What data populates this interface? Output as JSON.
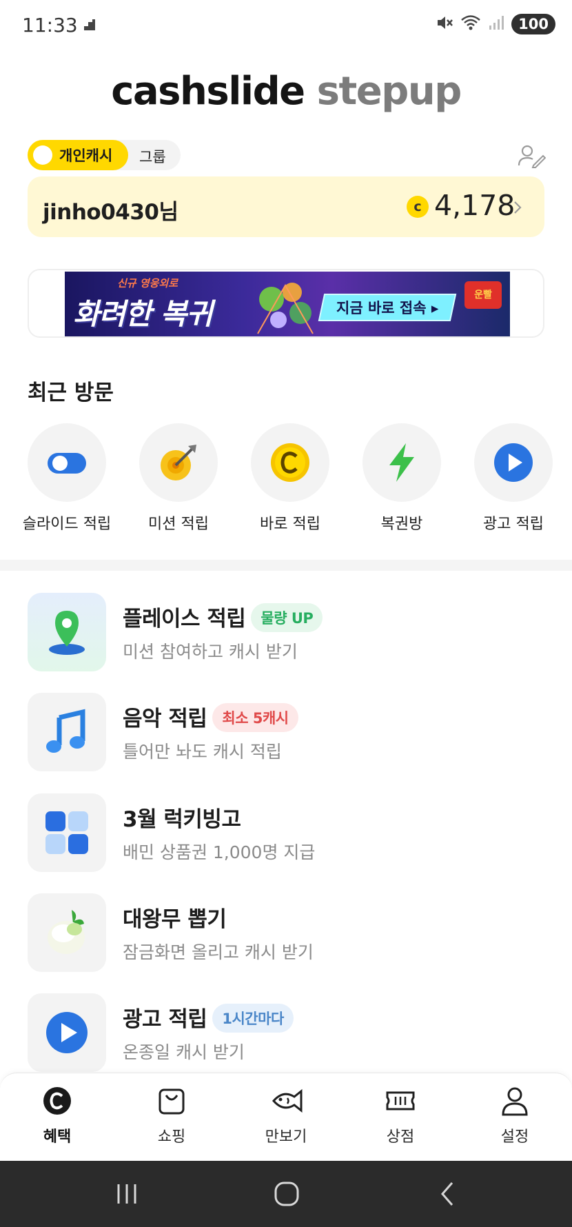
{
  "status_bar": {
    "time": "11:33",
    "battery": "100"
  },
  "logo": {
    "word1": "cashslide",
    "word2": "stepup"
  },
  "toggle": {
    "active_label": "개인캐시",
    "inactive_label": "그룹"
  },
  "cash_card": {
    "username": "jinho0430님",
    "coin_symbol": "c",
    "amount": "4,178"
  },
  "banner": {
    "subtitle": "신규 영웅외로",
    "headline": "화려한 복귀",
    "cta": "지금 바로 접속 ▸",
    "brand": "운빨"
  },
  "recent": {
    "title": "최근 방문",
    "items": [
      {
        "label": "슬라이드 적립",
        "icon": "toggle-switch-icon"
      },
      {
        "label": "미션 적립",
        "icon": "target-dart-icon"
      },
      {
        "label": "바로 적립",
        "icon": "coin-c-icon"
      },
      {
        "label": "복권방",
        "icon": "lightning-icon"
      },
      {
        "label": "광고 적립",
        "icon": "play-icon"
      }
    ]
  },
  "features": [
    {
      "title": "플레이스 적립",
      "badge": "물량 UP",
      "subtitle": "미션 참여하고 캐시 받기",
      "icon": "map-pin-icon"
    },
    {
      "title": "음악 적립",
      "badge": "최소 5캐시",
      "subtitle": "틀어만 놔도 캐시 적립",
      "icon": "music-note-icon"
    },
    {
      "title": "3월 럭키빙고",
      "badge": "",
      "subtitle": "배민 상품권 1,000명 지급",
      "icon": "bingo-grid-icon"
    },
    {
      "title": "대왕무 뽑기",
      "badge": "",
      "subtitle": "잠금화면 올리고 캐시 받기",
      "icon": "radish-icon"
    },
    {
      "title": "광고 적립",
      "badge": "1시간마다",
      "subtitle": "온종일 캐시 받기",
      "icon": "play-icon"
    }
  ],
  "tabs": [
    {
      "label": "혜택",
      "icon": "coin-c-icon",
      "active": true
    },
    {
      "label": "쇼핑",
      "icon": "shopping-bag-icon",
      "active": false
    },
    {
      "label": "만보기",
      "icon": "fish-icon",
      "active": false
    },
    {
      "label": "상점",
      "icon": "ticket-icon",
      "active": false
    },
    {
      "label": "설정",
      "icon": "person-icon",
      "active": false
    }
  ],
  "colors": {
    "accent_yellow": "#ffd800",
    "card_bg": "#fff8d4",
    "badge_green": "#27ae60",
    "badge_red": "#e04a4a",
    "badge_blue": "#4a86c8"
  }
}
